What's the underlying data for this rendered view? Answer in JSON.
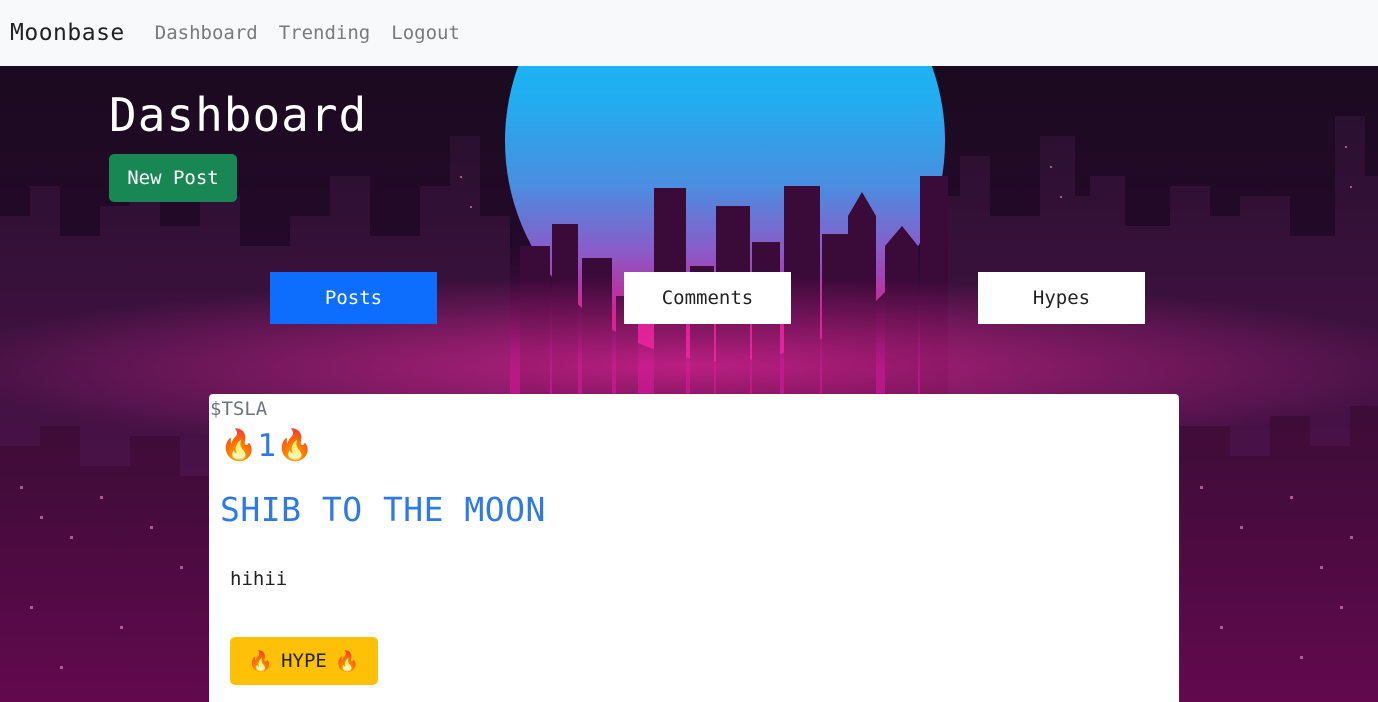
{
  "nav": {
    "brand": "Moonbase",
    "links": [
      "Dashboard",
      "Trending",
      "Logout"
    ]
  },
  "hero": {
    "title": "Dashboard",
    "new_post_label": "New Post"
  },
  "tabs": [
    {
      "label": "Posts",
      "active": true
    },
    {
      "label": "Comments",
      "active": false
    },
    {
      "label": "Hypes",
      "active": false
    }
  ],
  "post": {
    "ticker": "$TSLA",
    "hype_count": "1",
    "title": "SHIB TO THE MOON",
    "body": "hihii",
    "hype_button_label": "HYPE",
    "hype_icon": "fire-icon"
  },
  "colors": {
    "primary": "#0d6efd",
    "success": "#198754",
    "warning": "#ffc107",
    "link_blue": "#2d79e6",
    "muted": "#6c757d"
  }
}
